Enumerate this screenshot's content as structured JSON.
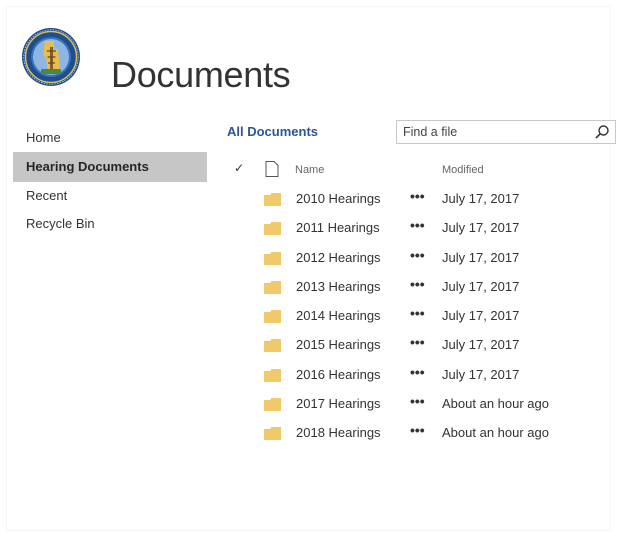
{
  "header": {
    "site_title": "Documents"
  },
  "nav": {
    "items": [
      {
        "label": "Home",
        "selected": false
      },
      {
        "label": "Hearing Documents",
        "selected": true
      },
      {
        "label": "Recent",
        "selected": false
      },
      {
        "label": "Recycle Bin",
        "selected": false
      }
    ]
  },
  "main": {
    "view_title": "All Documents",
    "search": {
      "placeholder": "Find a file"
    },
    "columns": {
      "check": "✓",
      "name": "Name",
      "modified": "Modified"
    },
    "more_glyph": "•••",
    "rows": [
      {
        "name": "2010 Hearings",
        "modified": "July 17, 2017"
      },
      {
        "name": "2011 Hearings",
        "modified": "July 17, 2017"
      },
      {
        "name": "2012 Hearings",
        "modified": "July 17, 2017"
      },
      {
        "name": "2013 Hearings",
        "modified": "July 17, 2017"
      },
      {
        "name": "2014 Hearings",
        "modified": "July 17, 2017"
      },
      {
        "name": "2015 Hearings",
        "modified": "July 17, 2017"
      },
      {
        "name": "2016 Hearings",
        "modified": "July 17, 2017"
      },
      {
        "name": "2017 Hearings",
        "modified": "About an hour ago"
      },
      {
        "name": "2018 Hearings",
        "modified": "About an hour ago"
      }
    ]
  },
  "colors": {
    "accent": "#2f5597",
    "nav_selected_bg": "#c6c6c6",
    "folder": "#f0c96b"
  },
  "icons": {
    "logo": "state-seal-logo",
    "search": "magnifier-icon",
    "document": "document-icon",
    "folder": "folder-icon",
    "more": "ellipsis-icon"
  }
}
